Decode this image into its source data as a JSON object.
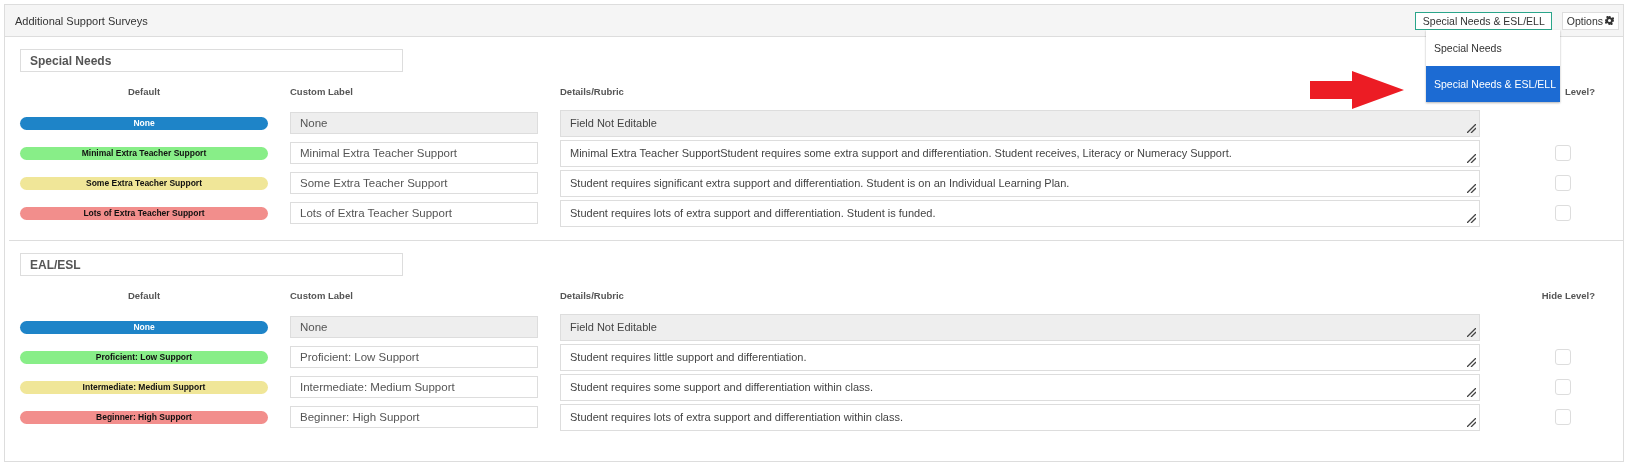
{
  "panel": {
    "title": "Additional Support Surveys",
    "survey_select": {
      "value": "Special Needs & ESL/ELL",
      "expanded": true,
      "options": [
        {
          "label": "Special Needs",
          "selected": false
        },
        {
          "label": "Special Needs & ESL/ELL",
          "selected": true
        }
      ]
    },
    "options_button": "Options"
  },
  "sections": [
    {
      "title": "Special Needs",
      "columns": [
        "Default",
        "Custom Label",
        "Details/Rubric",
        "Level?"
      ],
      "rows": [
        {
          "kind": "none",
          "default": "None",
          "color": "#1e84c8",
          "custom_label": "None",
          "details": "Field Not Editable"
        },
        {
          "kind": "level",
          "default": "Minimal Extra Teacher Support",
          "color": "#88ee88",
          "custom_label": "Minimal Extra Teacher Support",
          "details": "Minimal Extra Teacher SupportStudent requires some extra support and differentiation. Student receives, Literacy or Numeracy Support.",
          "hide_level": false
        },
        {
          "kind": "level",
          "default": "Some Extra Teacher Support",
          "color": "#f0e698",
          "custom_label": "Some Extra Teacher Support",
          "details": "Student requires significant extra support and differentiation. Student is on an Individual Learning Plan.",
          "hide_level": false
        },
        {
          "kind": "level",
          "default": "Lots of Extra Teacher Support",
          "color": "#f28e8c",
          "custom_label": "Lots of Extra Teacher Support",
          "details": "Student requires lots of extra support and differentiation. Student is funded.",
          "hide_level": false
        }
      ]
    },
    {
      "title": "EAL/ESL",
      "columns": [
        "Default",
        "Custom Label",
        "Details/Rubric",
        "Hide Level?"
      ],
      "rows": [
        {
          "kind": "none",
          "default": "None",
          "color": "#1e84c8",
          "custom_label": "None",
          "details": "Field Not Editable"
        },
        {
          "kind": "level",
          "default": "Proficient: Low Support",
          "color": "#88ee88",
          "custom_label": "Proficient: Low Support",
          "details": "Student requires little support and differentiation.",
          "hide_level": false
        },
        {
          "kind": "level",
          "default": "Intermediate: Medium Support",
          "color": "#f0e698",
          "custom_label": "Intermediate: Medium Support",
          "details": "Student requires some support and differentiation within class.",
          "hide_level": false
        },
        {
          "kind": "level",
          "default": "Beginner: High Support",
          "color": "#f28e8c",
          "custom_label": "Beginner: High Support",
          "details": "Student requires lots of extra support and differentiation within class.",
          "hide_level": false
        }
      ]
    }
  ]
}
